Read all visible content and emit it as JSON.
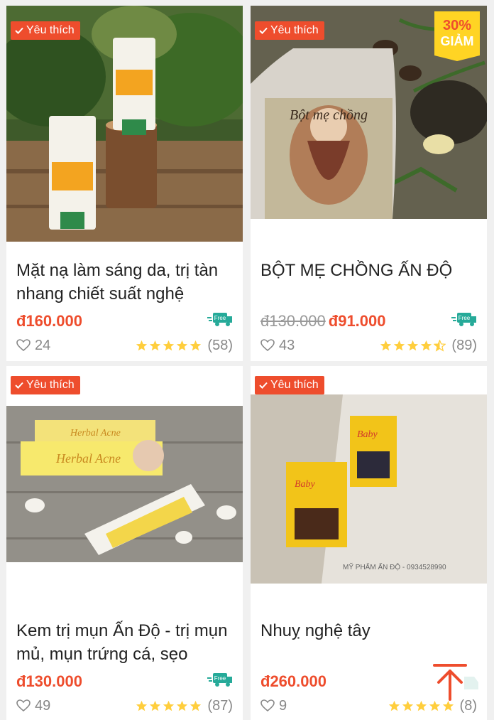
{
  "badge_label": "Yêu thích",
  "products": [
    {
      "title": "Mặt nạ làm sáng da, trị tàn nhang chiết suất nghệ",
      "price": "đ160.000",
      "old_price": "",
      "likes": "24",
      "rating_count": "(58)",
      "rating": 5,
      "free_ship": "Free",
      "image_desc": "himalaya-face-pack-photo"
    },
    {
      "title": "BỘT MẸ CHỒNG ẤN ĐỘ",
      "price": "đ91.000",
      "old_price": "đ130.000",
      "likes": "43",
      "rating_count": "(89)",
      "rating": 4.5,
      "free_ship": "Free",
      "discount_pct": "30%",
      "discount_label": "GIẢM",
      "image_desc": "bot-me-chong-pouch-photo"
    },
    {
      "title": "Kem trị mụn Ấn Độ - trị mụn mủ, mụn trứng cá, sẹo",
      "price": "đ130.000",
      "old_price": "",
      "likes": "49",
      "rating_count": "(87)",
      "rating": 5,
      "free_ship": "Free",
      "image_desc": "herbal-acne-cream-photo"
    },
    {
      "title": "Nhuỵ nghệ tây",
      "price": "đ260.000",
      "old_price": "",
      "likes": "9",
      "rating_count": "(8)",
      "rating": 5,
      "free_ship": "",
      "image_desc": "baby-saffron-photo"
    }
  ],
  "colors": {
    "accent": "#ee4d2d",
    "free_ship": "#26aa99",
    "star": "#ffce3d"
  }
}
